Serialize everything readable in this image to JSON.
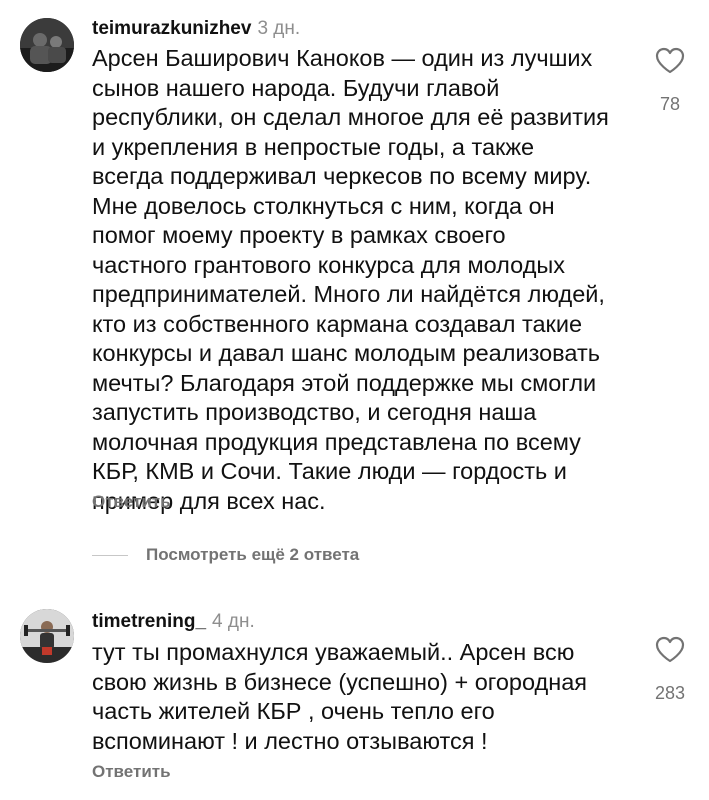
{
  "comments": [
    {
      "username": "teimurazkunizhev",
      "time": "3 дн.",
      "text": "Арсен Баширович Каноков — один из лучших\nсынов нашего народа. Будучи главой\nреспублики, он сделал многое для её развития\nи укрепления в непростые годы, а также\nвсегда поддерживал черкесов по всему миру.\nМне довелось столкнуться с ним, когда он\nпомог моему проекту в рамках своего\nчастного грантового конкурса для молодых\nпредпринимателей. Много ли найдётся людей,\nкто из собственного кармана создавал такие\nконкурсы и давал шанс молодым реализовать\nмечты? Благодаря этой поддержке мы смогли\nзапустить производство, и сегодня наша\nмолочная продукция представлена по всему\nКБР, КМВ и Сочи. Такие люди — гордость и\nпример для всех нас.",
      "likes": "78",
      "reply_label": "Ответить"
    },
    {
      "username": "timetrening_",
      "time": "4 дн.",
      "text": "тут ты промахнулся уважаемый.. Арсен всю\nсвою жизнь в бизнесе (успешно) +  огородная\nчасть жителей КБР , очень тепло его\nвспоминают ! и лестно отзываются !",
      "likes": "283",
      "reply_label": "Ответить"
    }
  ],
  "view_more_replies": "Посмотреть ещё 2 ответа",
  "icons": {
    "like": "heart-outline-icon"
  }
}
